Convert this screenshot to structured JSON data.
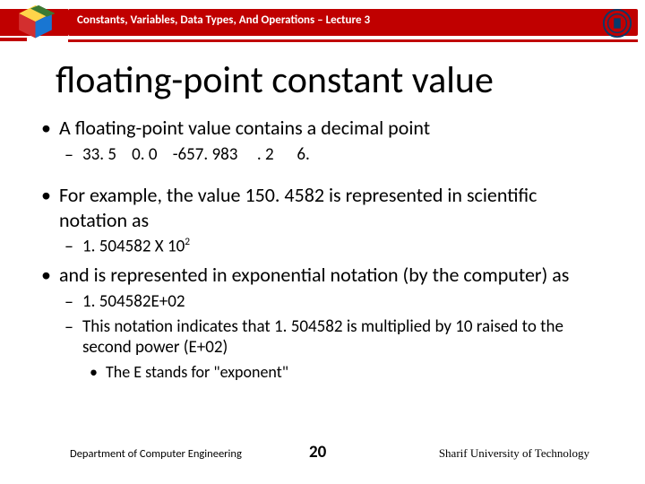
{
  "header": {
    "lecture": "Constants, Variables, Data Types, And Operations – Lecture 3"
  },
  "title": "floating-point constant value",
  "b1": {
    "text": "A floating-point value contains a decimal point",
    "sub1": "33. 5    0. 0    -657. 983     . 2      6."
  },
  "b2": {
    "text": "For example, the value 150. 4582 is represented in scientific notation as",
    "sub_base": "1. 504582  X 10",
    "sub_exp": "2"
  },
  "b3": {
    "text": "and is represented in exponential notation (by the computer) as",
    "sub1": "1. 504582E+02",
    "sub2": "This notation indicates that 1. 504582 is multiplied by 10 raised to the second power (E+02)",
    "sub3": "The E stands for \"exponent\""
  },
  "footer": {
    "left": "Department of Computer Engineering",
    "center": "20",
    "right": "Sharif University of Technology"
  }
}
